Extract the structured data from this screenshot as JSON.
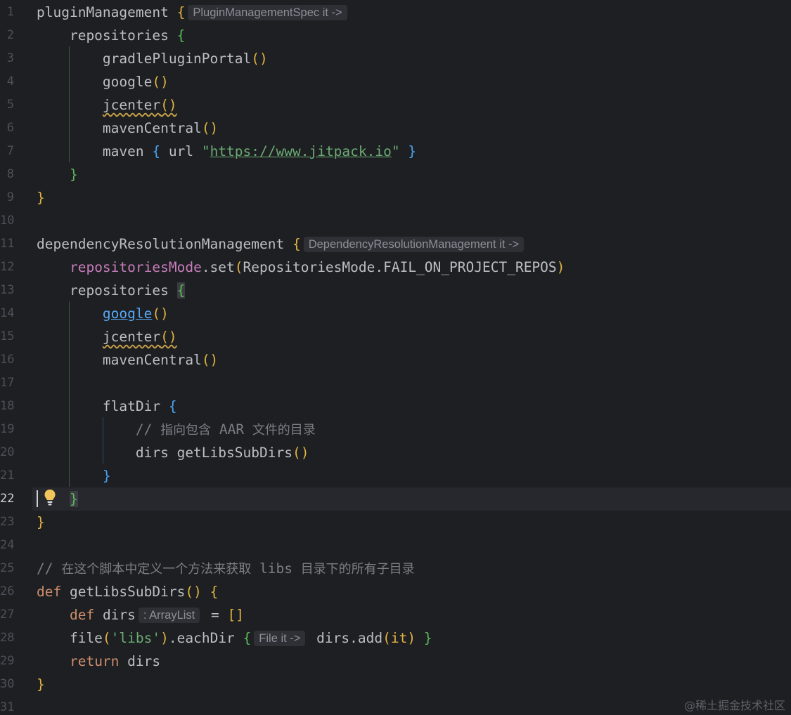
{
  "editor": {
    "language": "groovy",
    "current_line": 22,
    "watermark": "@稀土掘金技术社区",
    "line_numbers": [
      "1",
      "2",
      "3",
      "4",
      "5",
      "6",
      "7",
      "8",
      "9",
      "10",
      "11",
      "12",
      "13",
      "14",
      "15",
      "16",
      "17",
      "18",
      "19",
      "20",
      "21",
      "22",
      "23",
      "24",
      "25",
      "26",
      "27",
      "28",
      "29",
      "30",
      "31"
    ],
    "lines": [
      [
        {
          "t": "pluginManagement ",
          "c": "plain"
        },
        {
          "t": "{",
          "c": "b1"
        },
        {
          "t": "PluginManagementSpec it ->",
          "c": "hint"
        }
      ],
      [
        {
          "t": "    repositories ",
          "c": "plain"
        },
        {
          "t": "{",
          "c": "b2"
        }
      ],
      [
        {
          "t": "        gradlePluginPortal",
          "c": "plain"
        },
        {
          "t": "()",
          "c": "b1"
        }
      ],
      [
        {
          "t": "        google",
          "c": "plain"
        },
        {
          "t": "()",
          "c": "b1"
        }
      ],
      [
        {
          "t": "        ",
          "c": "plain"
        },
        {
          "t": "jcenter",
          "c": "plain warn"
        },
        {
          "t": "()",
          "c": "b1 warn"
        }
      ],
      [
        {
          "t": "        mavenCentral",
          "c": "plain"
        },
        {
          "t": "()",
          "c": "b1"
        }
      ],
      [
        {
          "t": "        maven ",
          "c": "plain"
        },
        {
          "t": "{",
          "c": "b3"
        },
        {
          "t": " url ",
          "c": "plain"
        },
        {
          "t": "\"",
          "c": "str"
        },
        {
          "t": "https://www.jitpack.io",
          "c": "url"
        },
        {
          "t": "\" ",
          "c": "str"
        },
        {
          "t": "}",
          "c": "b3"
        }
      ],
      [
        {
          "t": "    ",
          "c": "plain"
        },
        {
          "t": "}",
          "c": "b2"
        }
      ],
      [
        {
          "t": "}",
          "c": "b1"
        }
      ],
      [],
      [
        {
          "t": "dependencyResolutionManagement ",
          "c": "plain"
        },
        {
          "t": "{",
          "c": "b1"
        },
        {
          "t": "DependencyResolutionManagement it ->",
          "c": "hint"
        }
      ],
      [
        {
          "t": "    ",
          "c": "plain"
        },
        {
          "t": "repositoriesMode",
          "c": "prop"
        },
        {
          "t": ".set",
          "c": "plain"
        },
        {
          "t": "(",
          "c": "b1"
        },
        {
          "t": "RepositoriesMode.FAIL_ON_PROJECT_REPOS",
          "c": "plain"
        },
        {
          "t": ")",
          "c": "b1"
        }
      ],
      [
        {
          "t": "    repositories ",
          "c": "plain"
        },
        {
          "t": "{",
          "c": "b2 hl"
        }
      ],
      [
        {
          "t": "        ",
          "c": "plain"
        },
        {
          "t": "google",
          "c": "link"
        },
        {
          "t": "()",
          "c": "b1"
        }
      ],
      [
        {
          "t": "        ",
          "c": "plain"
        },
        {
          "t": "jcenter",
          "c": "plain warn"
        },
        {
          "t": "()",
          "c": "b1 warn"
        }
      ],
      [
        {
          "t": "        mavenCentral",
          "c": "plain"
        },
        {
          "t": "()",
          "c": "b1"
        }
      ],
      [],
      [
        {
          "t": "        flatDir ",
          "c": "plain"
        },
        {
          "t": "{",
          "c": "b3"
        }
      ],
      [
        {
          "t": "            // ",
          "c": "cmt"
        },
        {
          "t": "指向包含",
          "c": "cjk"
        },
        {
          "t": " AAR ",
          "c": "cmt"
        },
        {
          "t": "文件的目录",
          "c": "cjk"
        }
      ],
      [
        {
          "t": "            dirs getLibsSubDirs",
          "c": "plain"
        },
        {
          "t": "()",
          "c": "b1"
        }
      ],
      [
        {
          "t": "        ",
          "c": "plain"
        },
        {
          "t": "}",
          "c": "b3"
        }
      ],
      [
        {
          "t": "    ",
          "c": "plain"
        },
        {
          "t": "}",
          "c": "b2 hl"
        }
      ],
      [
        {
          "t": "}",
          "c": "b1"
        }
      ],
      [],
      [
        {
          "t": "// ",
          "c": "cmt"
        },
        {
          "t": "在这个脚本中定义一个方法来获取",
          "c": "cjk"
        },
        {
          "t": " libs ",
          "c": "cmt"
        },
        {
          "t": "目录下的所有子目录",
          "c": "cjk"
        }
      ],
      [
        {
          "t": "def ",
          "c": "kw"
        },
        {
          "t": "getLibsSubDirs",
          "c": "plain"
        },
        {
          "t": "() {",
          "c": "b1"
        }
      ],
      [
        {
          "t": "    ",
          "c": "plain"
        },
        {
          "t": "def ",
          "c": "kw"
        },
        {
          "t": "dirs",
          "c": "plain"
        },
        {
          "t": ": ArrayList",
          "c": "hint"
        },
        {
          "t": " = ",
          "c": "plain"
        },
        {
          "t": "[]",
          "c": "b1"
        }
      ],
      [
        {
          "t": "    file",
          "c": "plain"
        },
        {
          "t": "(",
          "c": "b1"
        },
        {
          "t": "'libs'",
          "c": "str"
        },
        {
          "t": ")",
          "c": "b1"
        },
        {
          "t": ".eachDir ",
          "c": "plain"
        },
        {
          "t": "{",
          "c": "b2"
        },
        {
          "t": "File it ->",
          "c": "hint"
        },
        {
          "t": " dirs.add",
          "c": "plain"
        },
        {
          "t": "(it)",
          "c": "b1"
        },
        {
          "t": " ",
          "c": "plain"
        },
        {
          "t": "}",
          "c": "b2"
        }
      ],
      [
        {
          "t": "    ",
          "c": "plain"
        },
        {
          "t": "return ",
          "c": "kw"
        },
        {
          "t": "dirs",
          "c": "plain"
        }
      ],
      [
        {
          "t": "}",
          "c": "b1"
        }
      ],
      []
    ]
  }
}
